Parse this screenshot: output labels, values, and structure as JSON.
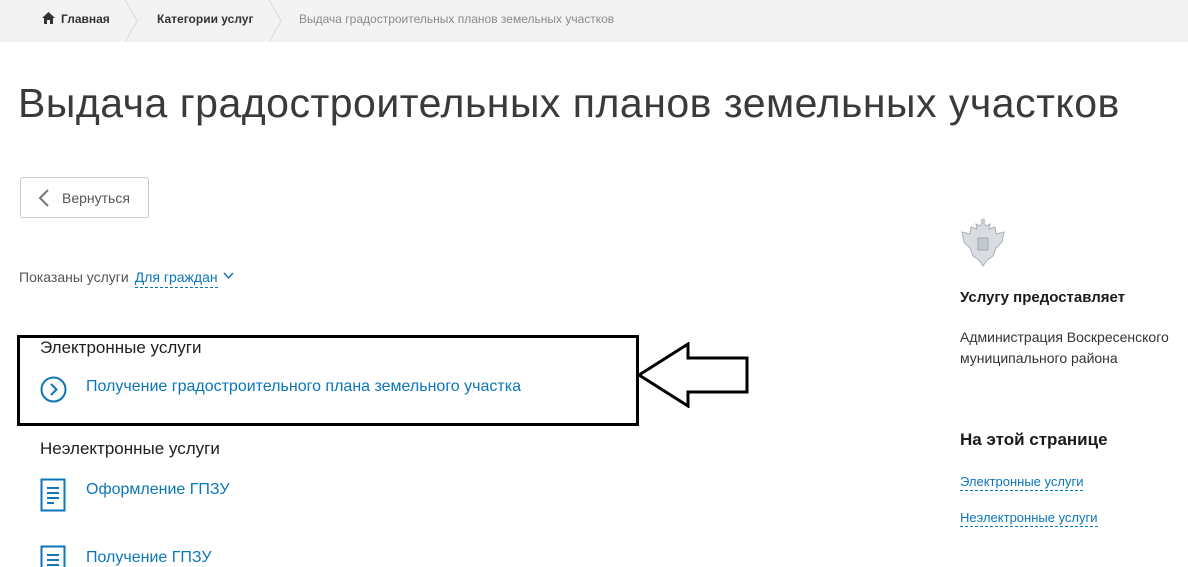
{
  "breadcrumb": {
    "home": "Главная",
    "categories": "Категории услуг",
    "current": "Выдача градостроительных планов земельных участков"
  },
  "page": {
    "title": "Выдача градостроительных планов земельных участков"
  },
  "back_button": {
    "label": "Вернуться"
  },
  "filter": {
    "label": "Показаны услуги",
    "value": "Для граждан"
  },
  "electronic": {
    "heading": "Электронные услуги",
    "items": [
      {
        "label": "Получение градостроительного плана земельного участка",
        "icon": "chevron-circle-icon"
      }
    ]
  },
  "non_electronic": {
    "heading": "Неэлектронные услуги",
    "items": [
      {
        "label": "Оформление ГПЗУ",
        "icon": "document-icon"
      },
      {
        "label": "Получение ГПЗУ",
        "icon": "document-icon"
      }
    ]
  },
  "sidebar": {
    "provider_heading": "Услугу предоставляет",
    "provider_name": "Администрация Воскресенского муниципального района",
    "on_page_heading": "На этой странице",
    "on_page_links": [
      "Электронные услуги",
      "Неэлектронные услуги"
    ]
  },
  "colors": {
    "link": "#0b76b8",
    "breadcrumb_bg": "#f3f3f3",
    "annotation": "#000000"
  }
}
